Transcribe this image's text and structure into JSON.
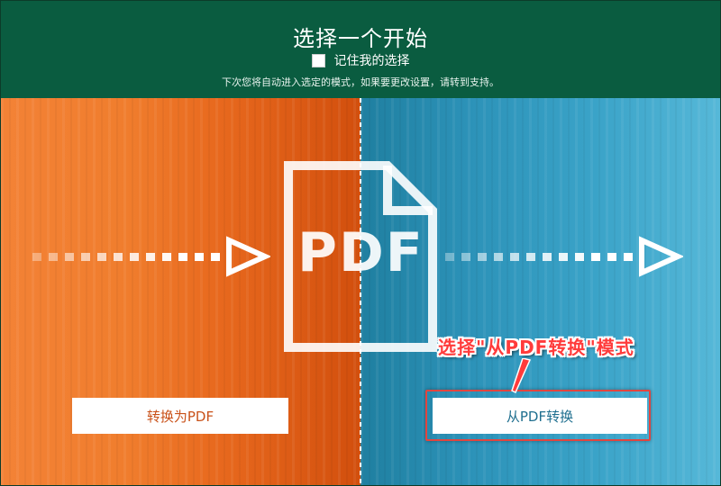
{
  "header": {
    "title": "选择一个开始",
    "remember_label": "记住我的选择",
    "hint": "下次您将自动进入选定的模式，如果要更改设置，请转到支持。"
  },
  "left_panel": {
    "button_label": "转换为PDF",
    "color": "#f07d2d"
  },
  "right_panel": {
    "button_label": "从PDF转换",
    "color": "#2c92b8"
  },
  "center_icon": {
    "icon": "pdf-document-icon",
    "text": "PDF"
  },
  "annotation": {
    "text": "选择\"从PDF转换\"模式",
    "color": "#ff3b3b"
  }
}
